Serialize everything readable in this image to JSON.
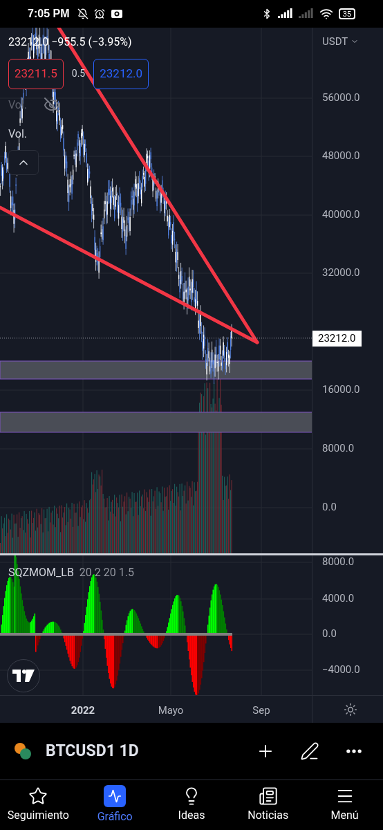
{
  "status_bar": {
    "time": "7:05 PM",
    "battery": "35"
  },
  "quote": {
    "price": "23212.0",
    "change": "−955.5 (−3.95%)",
    "currency": "USDT",
    "sell": "23211.5",
    "spread": "0.5",
    "buy": "23212.0"
  },
  "legend": [
    {
      "label": "Vol.",
      "hidden": true
    },
    {
      "label": "Vol.",
      "hidden": false
    }
  ],
  "price_axis": [
    "56000.0",
    "48000.0",
    "40000.0",
    "32000.0",
    "16000.0",
    "8000.0",
    "0.0"
  ],
  "last_price": "23212.0",
  "indicator": {
    "name": "SQZMOM_LB",
    "params": "20 2 20 1.5",
    "axis": [
      "8000.0",
      "4000.0",
      "0.0",
      "−4000.0"
    ]
  },
  "time_axis": [
    {
      "label": "2022",
      "bold": true
    },
    {
      "label": "Mayo",
      "bold": false
    },
    {
      "label": "Sep",
      "bold": false
    }
  ],
  "symbol": {
    "name": "BTCUSD1 1D"
  },
  "nav": [
    {
      "label": "Seguimiento",
      "selected": false,
      "kind": "star"
    },
    {
      "label": "Gráfico",
      "selected": true,
      "kind": "chart"
    },
    {
      "label": "Ideas",
      "selected": false,
      "kind": "idea"
    },
    {
      "label": "Noticias",
      "selected": false,
      "kind": "news"
    },
    {
      "label": "Menú",
      "selected": false,
      "kind": "menu"
    }
  ]
}
